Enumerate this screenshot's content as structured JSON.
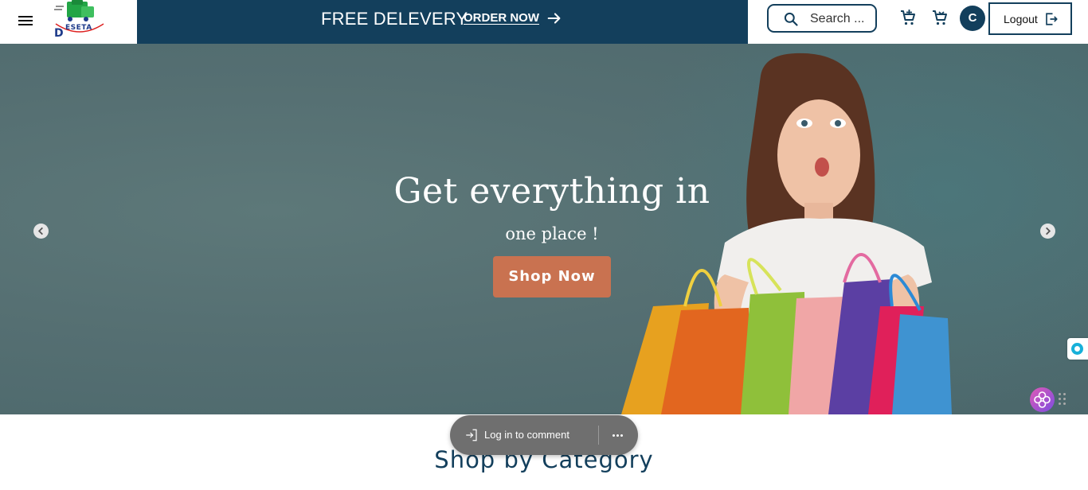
{
  "header": {
    "logo_text": "ESETA",
    "promo": {
      "text": "FREE DELEVERY",
      "link": "ORDER NOW"
    },
    "search": {
      "placeholder": "Search ..."
    },
    "avatar_initial": "C",
    "logout_label": "Logout"
  },
  "hero": {
    "title": "Get everything in",
    "subtitle": "one place !",
    "cta": "Shop Now"
  },
  "comment_bar": {
    "login_label": "Log in to comment"
  },
  "section": {
    "title": "Shop by Category"
  },
  "colors": {
    "primary": "#133f5c",
    "cta": "#c97250",
    "hero_bg": "#556f72"
  }
}
